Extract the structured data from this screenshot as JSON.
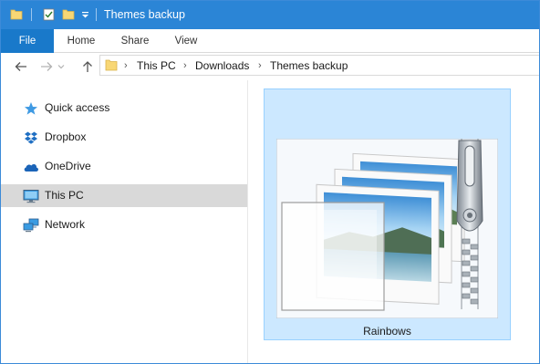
{
  "window": {
    "title": "Themes backup",
    "accent_color": "#2b85d6"
  },
  "quick_access_toolbar": {
    "icons": [
      "folder-icon",
      "properties-icon",
      "new-folder-icon",
      "customize-dropdown-icon"
    ]
  },
  "ribbon": {
    "tabs": [
      {
        "label": "File",
        "active": true
      },
      {
        "label": "Home"
      },
      {
        "label": "Share"
      },
      {
        "label": "View"
      }
    ]
  },
  "navigation": {
    "back_icon": "back-arrow-icon",
    "forward_icon": "forward-arrow-icon",
    "recent_icon": "chevron-down-icon",
    "up_icon": "up-arrow-icon"
  },
  "address_bar": {
    "folder_icon": "folder-icon",
    "breadcrumbs": [
      "This PC",
      "Downloads",
      "Themes backup"
    ],
    "separator": "›"
  },
  "sidebar": {
    "items": [
      {
        "label": "Quick access",
        "icon": "star-icon"
      },
      {
        "label": "Dropbox",
        "icon": "dropbox-icon"
      },
      {
        "label": "OneDrive",
        "icon": "cloud-icon"
      },
      {
        "label": "This PC",
        "icon": "monitor-icon",
        "selected": true
      },
      {
        "label": "Network",
        "icon": "network-icon"
      }
    ]
  },
  "content": {
    "files": [
      {
        "name": "Rainbows",
        "type": "zipped theme pack",
        "selected": true
      }
    ]
  }
}
